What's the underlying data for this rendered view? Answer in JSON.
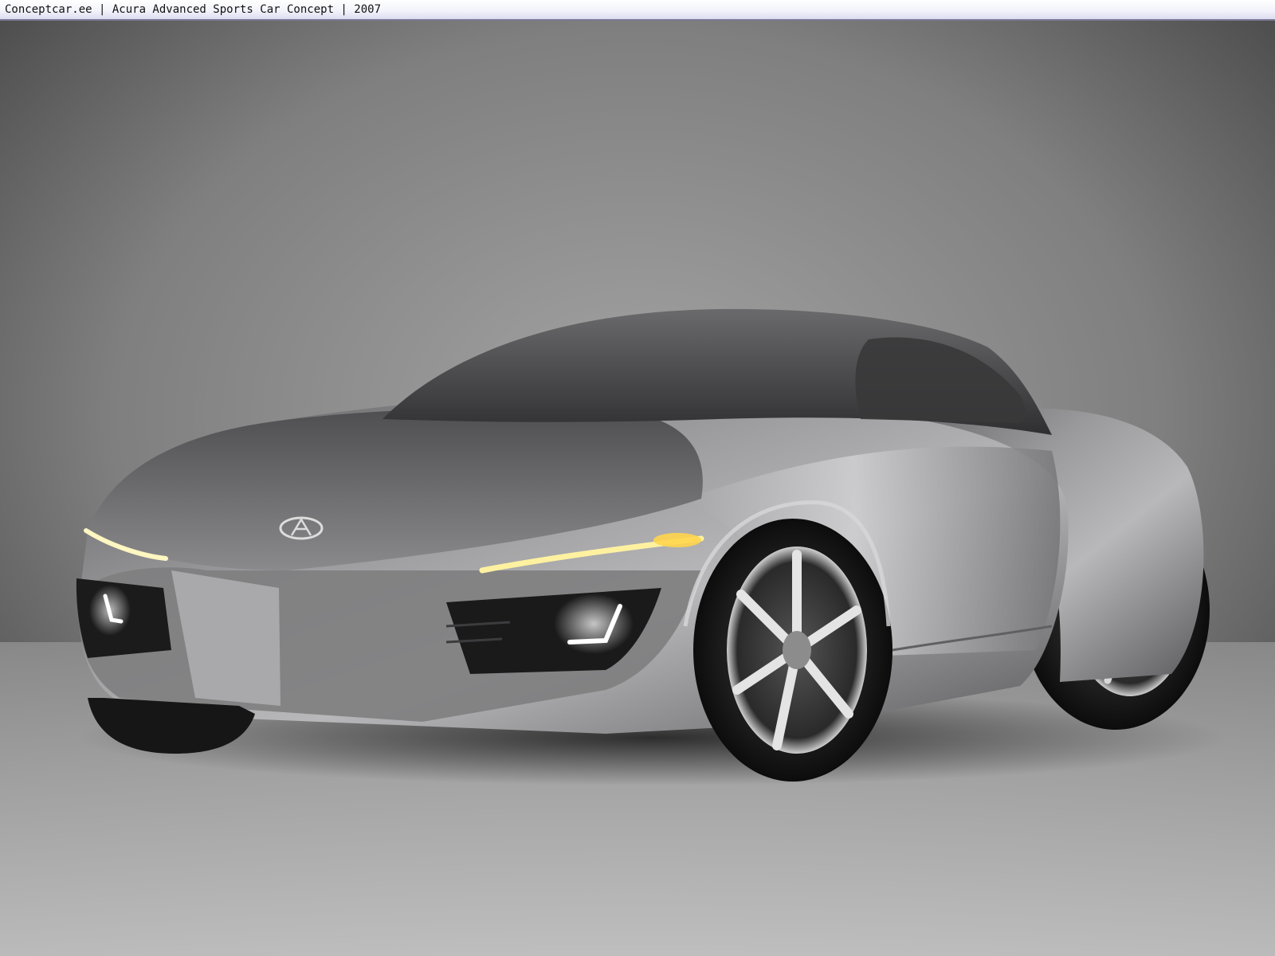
{
  "caption": {
    "text": "Conceptcar.ee | Acura Advanced Sports Car Concept | 2007"
  },
  "photo": {
    "backdrop_color_top": "#3d3d3d",
    "backdrop_color_mid": "#9a9a9a",
    "floor_color": "#b9b9b9",
    "car_body_color": "#8e8e90",
    "headlight_color": "#fff3b0",
    "foglight_color": "#f4f8ff"
  }
}
